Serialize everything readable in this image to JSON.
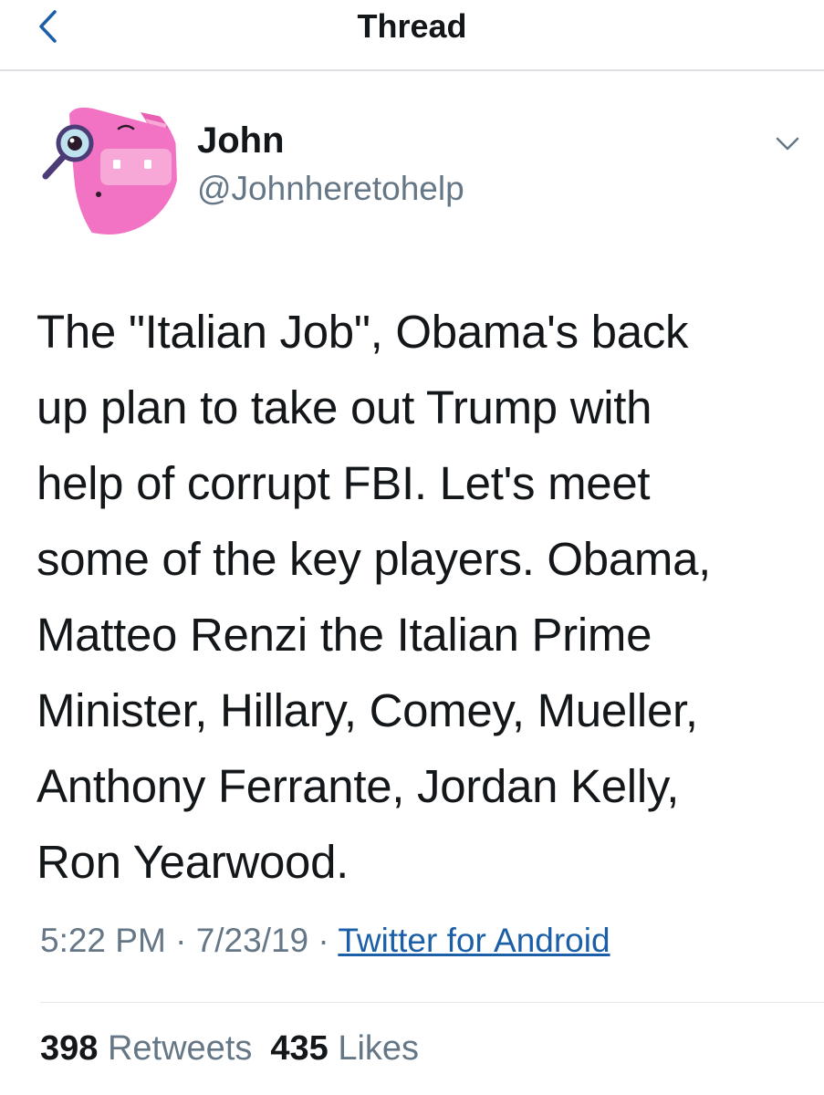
{
  "header": {
    "title": "Thread",
    "back_icon": "chevron-left-icon",
    "accent_color": "#1b5fa8"
  },
  "tweet": {
    "author": {
      "display_name": "John",
      "handle": "@Johnheretohelp",
      "avatar_icon": "pink-pig-with-magnifying-glass"
    },
    "menu_icon": "chevron-down-icon",
    "text_lines": [
      "The \"Italian Job\", Obama's back",
      "up plan to take out Trump with",
      "help of corrupt FBI. Let's meet",
      "some of the key players. Obama,",
      "Matteo Renzi the Italian Prime",
      "Minister, Hillary, Comey, Mueller,",
      "Anthony Ferrante, Jordan Kelly,",
      "Ron Yearwood."
    ],
    "time": "5:22 PM",
    "separator": "·",
    "date": "7/23/19",
    "source": "Twitter for Android",
    "retweets_count": "398",
    "retweets_label": "Retweets",
    "likes_count": "435",
    "likes_label": "Likes"
  }
}
